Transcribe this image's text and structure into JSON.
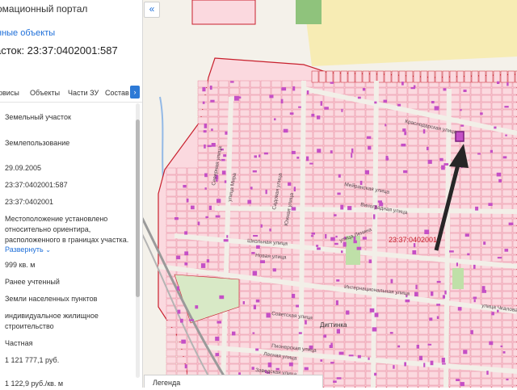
{
  "panel": {
    "portal_title": "омационный портал",
    "related_link": "нные объекты",
    "parcel_heading": "асток: 23:37:0402001:587",
    "tabs": [
      "рвисы",
      "Объекты",
      "Части ЗУ",
      "Состав"
    ],
    "tab_next_icon": "chevron-right-icon",
    "fields": [
      "Земельный участок",
      "Землепользование",
      "29.09.2005",
      "23:37:0402001:587",
      "23:37:0402001",
      "Местоположение установлено относительно ориентира, расположенного в границах участка.",
      "999 кв. м",
      "Ранее учтенный",
      "Земли населенных пунктов",
      "индивидуальное жилищное строительство",
      "Частная",
      "1 121 777,1 руб.",
      "1 122,9 руб./кв. м"
    ],
    "expand_label": "Развернуть",
    "expand_icon": "chevron-down-icon"
  },
  "map": {
    "collapse_icon": "double-chevron-left-icon",
    "legend_label": "Легенда",
    "labels": {
      "block_number": "23:37:0402001",
      "streets": [
        "Краснодарская улица",
        "Виноградная улица",
        "Мейранская улица",
        "Новая улица",
        "Советская улица",
        "Интернациональная улица",
        "улица Ленина",
        "Школьная улица",
        "Пионерская улица",
        "улица Чкалова",
        "Северная улица",
        "улица Мира",
        "Садовая улица",
        "Южная улица",
        "Лесная улица",
        "Заводская улица"
      ],
      "village": "Дигтинка"
    },
    "colors": {
      "parcel_fill": "#fbd9df",
      "parcel_border": "#e26b86",
      "quarter_border": "#c8202d",
      "building": "#c44fc6",
      "road": "#f2efe8",
      "green": "#bfe0a8",
      "field": "#f7ecb4",
      "water": "#93b9e6",
      "rail": "#9a9a9a",
      "arrow": "#262626"
    }
  }
}
